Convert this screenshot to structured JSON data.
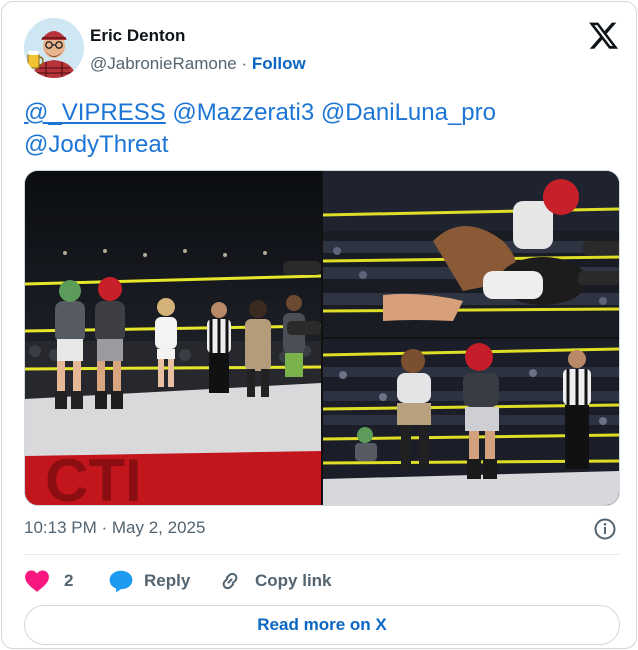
{
  "author": {
    "name": "Eric Denton",
    "handle": "@JabronieRamone",
    "separator": "·",
    "follow_label": "Follow"
  },
  "tweet": {
    "mentions": [
      "@_VIPRESS",
      "@Mazzerati3",
      "@DaniLuna_pro",
      "@JodyThreat"
    ]
  },
  "media": {
    "photos": [
      "photo-wrestlers-ring-lineup",
      "photo-wrestling-action-top",
      "photo-wrestling-action-bottom"
    ]
  },
  "meta": {
    "timestamp": "10:13 PM · May 2, 2025"
  },
  "actions": {
    "like_count": "2",
    "reply_label": "Reply",
    "copy_link_label": "Copy link"
  },
  "footer": {
    "read_more_label": "Read more on X"
  },
  "colors": {
    "link": "#1d75d6",
    "follow": "#0a66c2",
    "like": "#f91880",
    "reply": "#1d9bf0",
    "muted": "#536471",
    "border": "#cfd9de"
  },
  "icons": [
    "avatar",
    "x-logo-icon",
    "info-icon",
    "heart-icon",
    "reply-bubble-icon",
    "link-icon"
  ]
}
